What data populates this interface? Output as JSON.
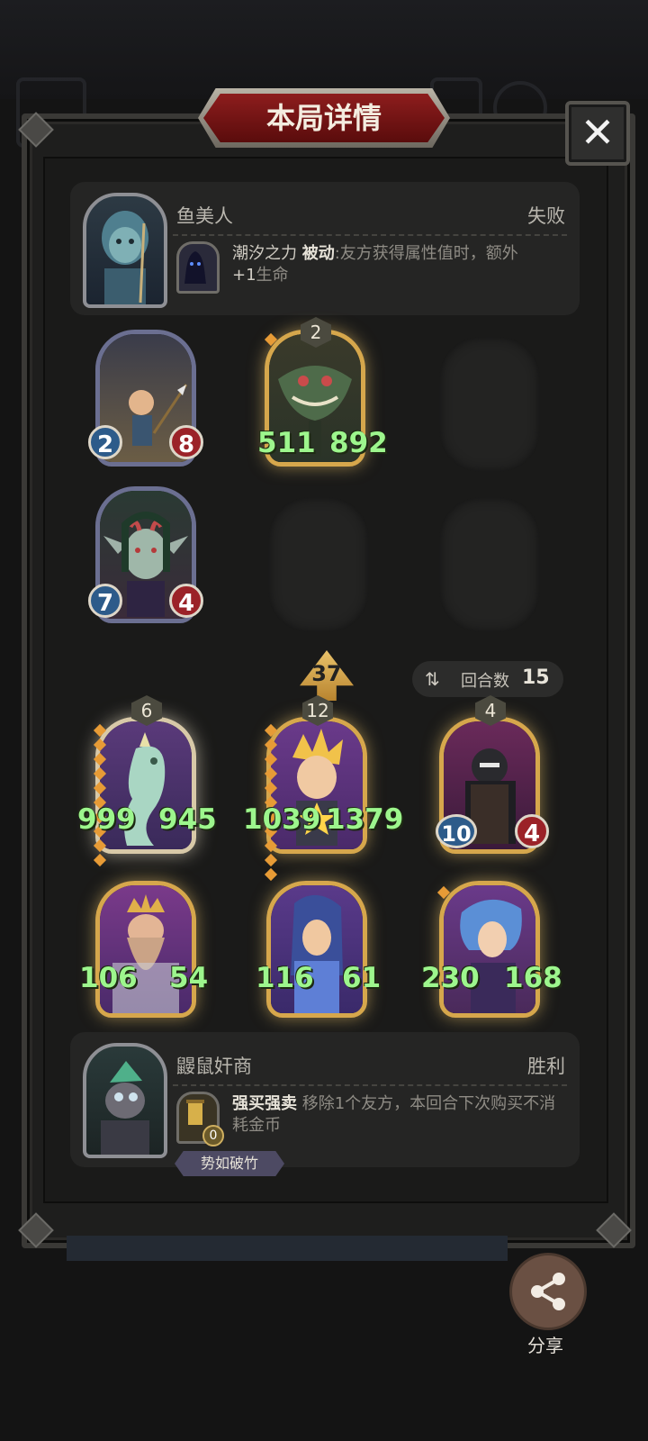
{
  "header": {
    "title": "本局详情"
  },
  "opponent": {
    "name": "鱼美人",
    "result": "失败",
    "ability_name": "潮汐之力",
    "ability_type": "被动",
    "ability_desc": ":友方获得属性值时，额外",
    "ability_bonus": "+1",
    "ability_desc2": "生命"
  },
  "opponent_board": [
    {
      "atk": "2",
      "hp": "8"
    },
    {
      "level": "2",
      "atk": "511",
      "hp": "892"
    },
    {
      "atk": "7",
      "hp": "4"
    }
  ],
  "battle": {
    "score": "37",
    "round_label": "回合数",
    "round_value": "15"
  },
  "player_board": [
    {
      "level": "6",
      "atk": "999",
      "hp": "945"
    },
    {
      "level": "12",
      "atk": "1039",
      "hp": "1379"
    },
    {
      "level": "4",
      "atk": "10",
      "hp": "4"
    },
    {
      "atk": "106",
      "hp": "54"
    },
    {
      "atk": "116",
      "hp": "61"
    },
    {
      "atk": "230",
      "hp": "168"
    }
  ],
  "player": {
    "name": "鼹鼠奸商",
    "result": "胜利",
    "ability_name": "强买强卖",
    "ability_desc": "移除1个友方，本回合下次购买不消耗金币",
    "ability_cost": "0",
    "badge": "势如破竹"
  },
  "footer": {
    "share_label": "分享"
  },
  "icons": {
    "close": "close-icon",
    "share": "share-icon",
    "round": "swap-arrows-icon"
  }
}
